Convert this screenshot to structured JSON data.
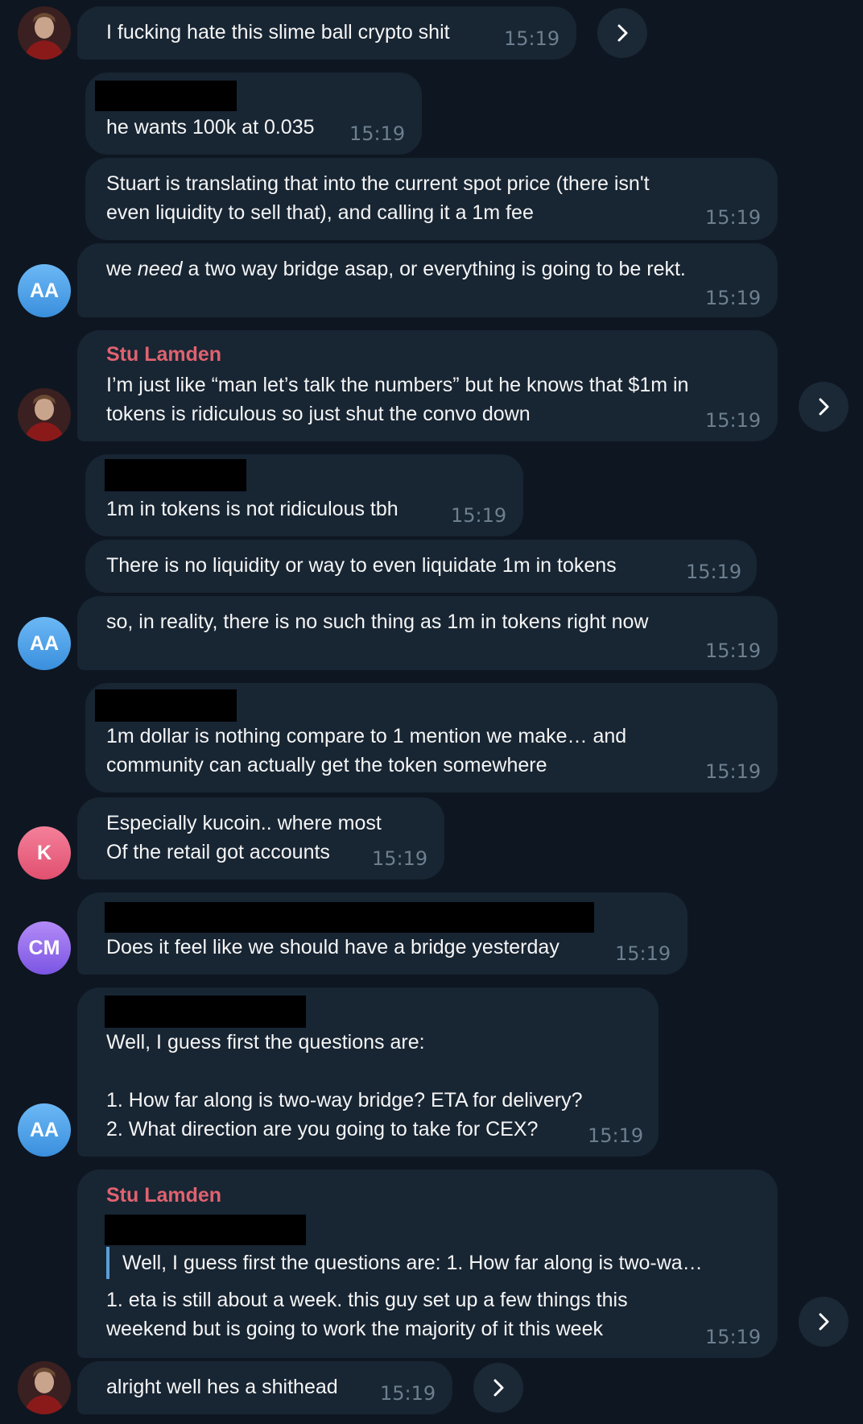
{
  "messages": [
    {
      "text": "I fucking hate this slime ball crypto shit",
      "time": "15:19"
    },
    {
      "text": "he wants 100k at 0.035",
      "time": "15:19"
    },
    {
      "text": "Stuart is translating that into the current spot price (there isn't\neven liquidity to sell that), and calling it a 1m fee",
      "time": "15:19"
    },
    {
      "text_pre": "we ",
      "text_em": "need",
      "text_post": " a two way bridge asap, or everything is going to be rekt.",
      "time": "15:19"
    },
    {
      "sender": "Stu Lamden",
      "text": "I’m just like “man let’s talk the numbers” but he knows that $1m in\ntokens is ridiculous so just shut the convo down",
      "time": "15:19"
    },
    {
      "text": "1m in tokens is not ridiculous tbh",
      "time": "15:19"
    },
    {
      "text": "There is no liquidity or way to even liquidate 1m in tokens",
      "time": "15:19"
    },
    {
      "text": "so, in reality, there is no such thing as 1m in tokens right now",
      "time": "15:19"
    },
    {
      "text": "1m dollar is nothing compare to 1 mention we make… and\ncommunity can actually get the token somewhere",
      "time": "15:19"
    },
    {
      "text": "Especially kucoin.. where most\nOf the retail got accounts",
      "time": "15:19"
    },
    {
      "text": "Does it feel like we should have a bridge yesterday",
      "time": "15:19"
    },
    {
      "text": "Well, I guess first the questions are:\n\n1. How far along is two-way bridge? ETA for delivery?\n2. What direction are you going to take for CEX?",
      "time": "15:19"
    },
    {
      "sender": "Stu Lamden",
      "quote": "Well, I guess first the questions are:  1. How far along is two-wa…",
      "text": "1. eta is still about a week. this guy set up a few things this\nweekend but is going to work the majority of it this week",
      "time": "15:19"
    },
    {
      "text": "alright well hes a shithead",
      "time": "15:19"
    }
  ],
  "avatars": {
    "aa": "AA",
    "k": "K",
    "cm": "CM"
  },
  "colors": {
    "background": "#0e1621",
    "bubble": "#182533",
    "sender_name": "#e0626f",
    "time": "#6d7f8f",
    "quote_bar": "#5a9fd6"
  },
  "icons": {
    "forward": "chevron-right-icon",
    "photo_avatar": "user-photo"
  }
}
